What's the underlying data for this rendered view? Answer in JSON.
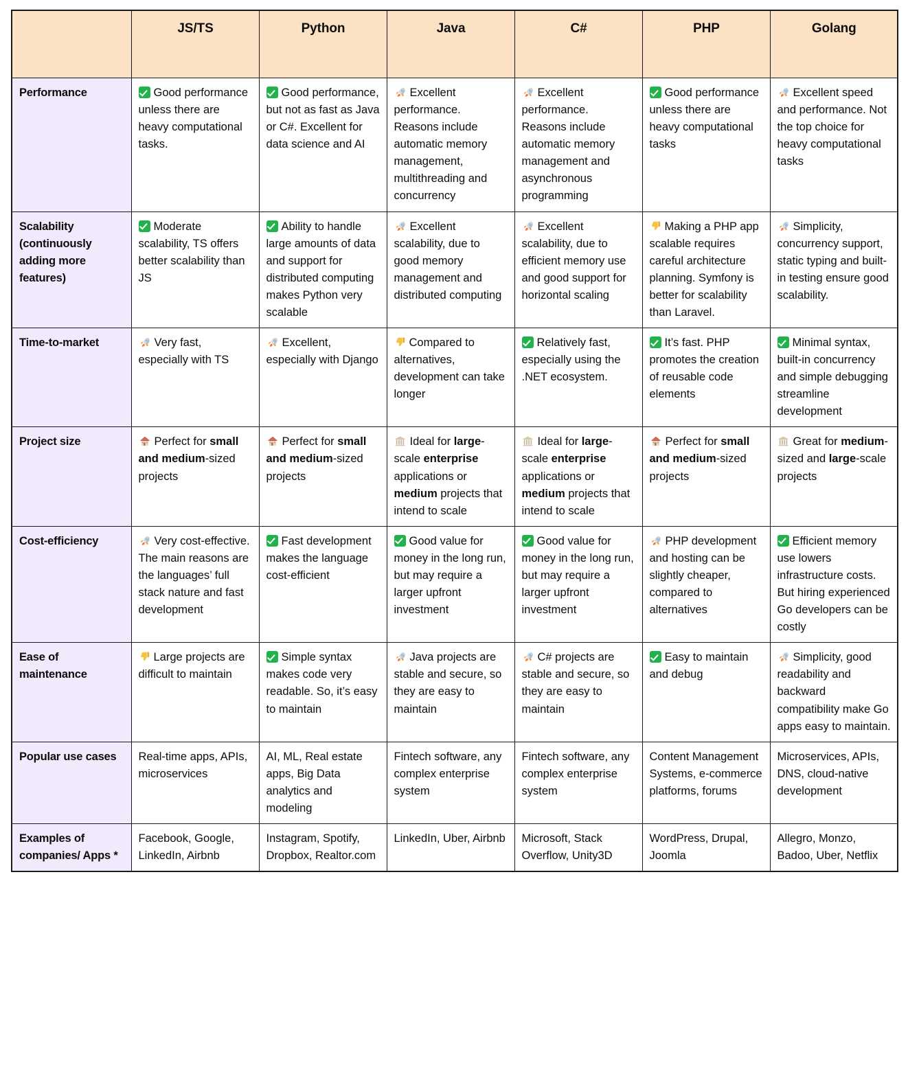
{
  "table": {
    "columns": [
      "",
      "JS/TS",
      "Python",
      "Java",
      "C#",
      "PHP",
      "Golang"
    ],
    "colors": {
      "header_bg": "#FBE2C5",
      "criteria_bg": "#F1EAFC",
      "cell_bg": "#FFFFFF",
      "border": "#1B1B1B",
      "check_green": "#22B24C"
    },
    "rows": [
      {
        "criteria": "Performance",
        "cells": [
          {
            "icon": "check-icon",
            "text": "Good performance unless there are heavy computational tasks."
          },
          {
            "icon": "check-icon",
            "text": "Good performance, but not as fast as Java or C#. Excellent for data science and AI"
          },
          {
            "icon": "rocket-icon",
            "text": "Excellent performance. Reasons include automatic memory management, multithreading and concurrency"
          },
          {
            "icon": "rocket-icon",
            "text": "Excellent performance. Reasons include automatic memory management and asynchronous programming"
          },
          {
            "icon": "check-icon",
            "text": "Good performance unless there are heavy computational tasks"
          },
          {
            "icon": "rocket-icon",
            "text": "Excellent speed and performance. Not the top choice for heavy computational tasks"
          }
        ]
      },
      {
        "criteria": "Scalability (continuously adding more features)",
        "cells": [
          {
            "icon": "check-icon",
            "text": "Moderate scalability, TS offers better scalability than JS"
          },
          {
            "icon": "check-icon",
            "text": "Ability to handle large amounts of data and support for distributed computing makes Python very scalable"
          },
          {
            "icon": "rocket-icon",
            "text": "Excellent scalability, due to good memory management and distributed computing"
          },
          {
            "icon": "rocket-icon",
            "text": "Excellent scalability, due to efficient memory use and good support for horizontal scaling"
          },
          {
            "icon": "thumbs-down-icon",
            "text": "Making a PHP app scalable requires careful architecture planning. Symfony is better for scalability than Laravel."
          },
          {
            "icon": "rocket-icon",
            "text": "Simplicity, concurrency support, static typing and built-in testing ensure good scalability."
          }
        ]
      },
      {
        "criteria": "Time-to-market",
        "cells": [
          {
            "icon": "rocket-icon",
            "text": "Very fast, especially with TS"
          },
          {
            "icon": "rocket-icon",
            "text": "Excellent, especially with Django"
          },
          {
            "icon": "thumbs-down-icon",
            "text": "Compared to alternatives, development can take longer"
          },
          {
            "icon": "check-icon",
            "text": "Relatively fast, especially using the .NET ecosystem."
          },
          {
            "icon": "check-icon",
            "text": "It’s fast. PHP promotes the creation of reusable code elements"
          },
          {
            "icon": "check-icon",
            "text": "Minimal syntax, built-in concurrency and simple debugging streamline development"
          }
        ]
      },
      {
        "criteria": "Project size",
        "cells": [
          {
            "icon": "house-icon",
            "html": "Perfect for <b>small and medium</b>-sized projects"
          },
          {
            "icon": "house-icon",
            "html": "Perfect for <b>small and medium</b>-sized projects"
          },
          {
            "icon": "building-icon",
            "html": "Ideal for <b>large</b>-scale <b>enterprise</b> applications or <b>medium</b> projects that intend to scale"
          },
          {
            "icon": "building-icon",
            "html": "Ideal for <b>large</b>-scale <b>enterprise</b> applications or <b>medium</b> projects that intend to scale"
          },
          {
            "icon": "house-icon",
            "html": "Perfect for <b>small and medium</b>-sized projects"
          },
          {
            "icon": "building-icon",
            "html": "Great for <b>medium</b>-sized and <b>large</b>-scale projects"
          }
        ]
      },
      {
        "criteria": "Cost-efficiency",
        "cells": [
          {
            "icon": "rocket-icon",
            "text": "Very cost-effective. The main reasons are the languages’ full stack nature and fast development"
          },
          {
            "icon": "check-icon",
            "text": "Fast development makes the language cost-efficient"
          },
          {
            "icon": "check-icon",
            "text": "Good value for money in the long run, but may require a larger upfront investment"
          },
          {
            "icon": "check-icon",
            "text": "Good value for money in the long run, but may require a larger upfront investment"
          },
          {
            "icon": "rocket-icon",
            "text": "PHP development and hosting can be slightly cheaper, compared to alternatives"
          },
          {
            "icon": "check-icon",
            "text": "Efficient memory use lowers infrastructure costs. But hiring experienced Go developers can be costly"
          }
        ]
      },
      {
        "criteria": "Ease of maintenance",
        "cells": [
          {
            "icon": "thumbs-down-icon",
            "text": "Large projects are difficult to maintain"
          },
          {
            "icon": "check-icon",
            "text": "Simple syntax makes code very readable. So, it’s easy to maintain"
          },
          {
            "icon": "rocket-icon",
            "text": "Java projects are stable and secure, so they are easy to maintain"
          },
          {
            "icon": "rocket-icon",
            "text": "C# projects are stable and secure, so they are easy to maintain"
          },
          {
            "icon": "check-icon",
            "text": "Easy to maintain and debug"
          },
          {
            "icon": "rocket-icon",
            "text": "Simplicity, good readability and backward compatibility make Go apps easy to maintain."
          }
        ]
      },
      {
        "criteria": "Popular use cases",
        "cells": [
          {
            "icon": "",
            "text": "Real-time apps, APIs, microservices"
          },
          {
            "icon": "",
            "text": "AI, ML, Real estate apps, Big Data analytics and modeling"
          },
          {
            "icon": "",
            "text": "Fintech software, any complex enterprise system"
          },
          {
            "icon": "",
            "text": "Fintech software, any complex enterprise system"
          },
          {
            "icon": "",
            "text": "Content Management Systems, e-commerce platforms, forums"
          },
          {
            "icon": "",
            "text": "Microservices, APIs, DNS, cloud-native development"
          }
        ]
      },
      {
        "criteria": "Examples of companies/ Apps *",
        "cells": [
          {
            "icon": "",
            "text": "Facebook, Google, LinkedIn, Airbnb"
          },
          {
            "icon": "",
            "text": "Instagram, Spotify, Dropbox, Realtor.com"
          },
          {
            "icon": "",
            "text": "LinkedIn, Uber, Airbnb"
          },
          {
            "icon": "",
            "text": "Microsoft, Stack Overflow, Unity3D"
          },
          {
            "icon": "",
            "text": "WordPress, Drupal, Joomla"
          },
          {
            "icon": "",
            "text": "Allegro, Monzo, Badoo, Uber, Netflix"
          }
        ]
      }
    ]
  }
}
